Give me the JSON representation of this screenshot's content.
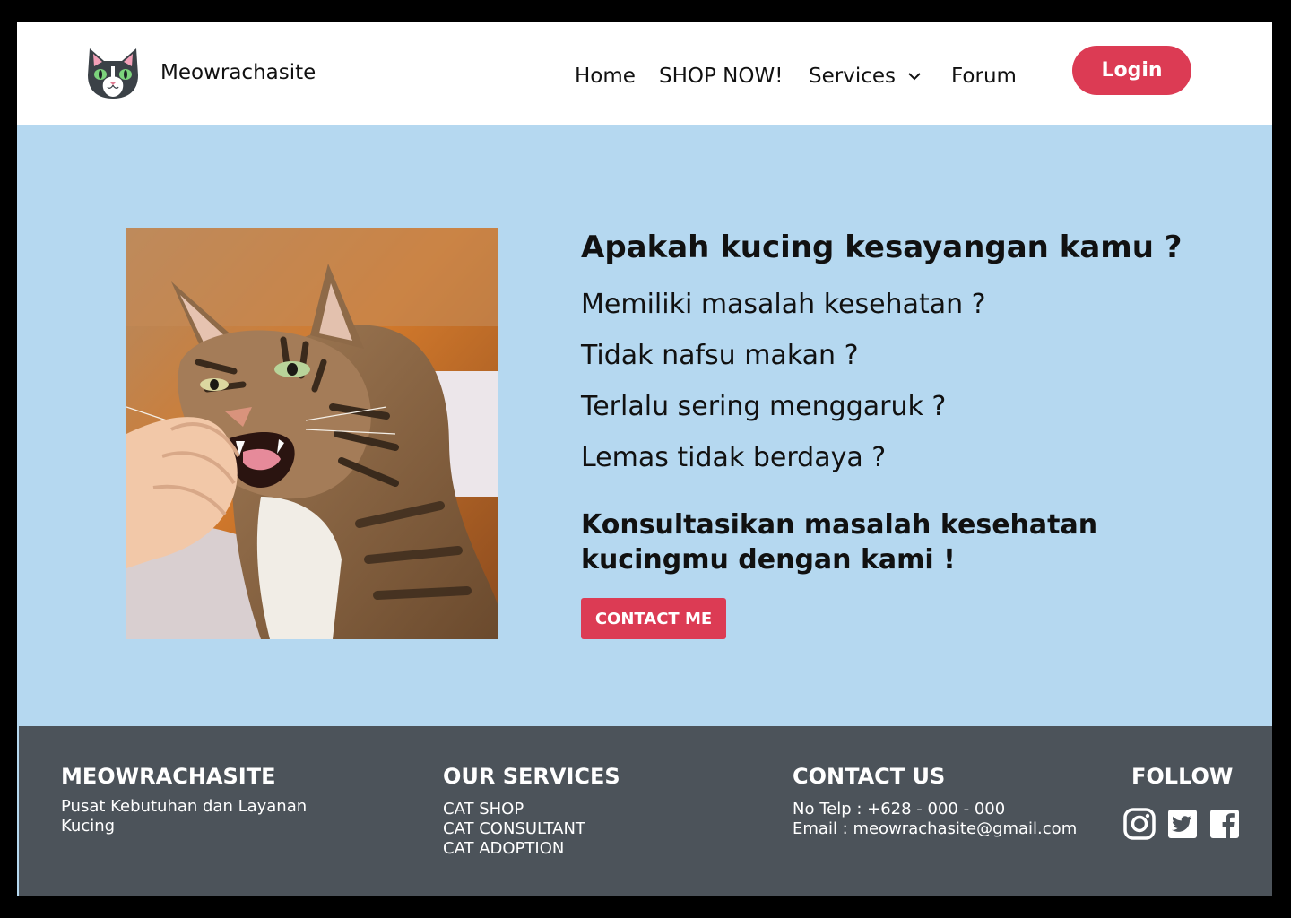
{
  "header": {
    "brand": "Meowrachasite",
    "nav": {
      "home": "Home",
      "shop": "SHOP NOW!",
      "services": "Services",
      "forum": "Forum"
    },
    "login_label": "Login"
  },
  "hero": {
    "title": "Apakah kucing kesayangan kamu ?",
    "questions": [
      "Memiliki masalah kesehatan ?",
      "Tidak nafsu makan ?",
      "Terlalu sering menggaruk ?",
      "Lemas tidak berdaya ?"
    ],
    "cta_title": "Konsultasikan masalah kesehatan kucingmu dengan kami !",
    "contact_label": "CONTACT ME"
  },
  "footer": {
    "brand": {
      "heading": "MEOWRACHASITE",
      "tagline": "Pusat Kebutuhan dan Layanan Kucing"
    },
    "services": {
      "heading": "OUR SERVICES",
      "items": [
        "CAT SHOP",
        "CAT CONSULTANT",
        "CAT ADOPTION"
      ]
    },
    "contact": {
      "heading": "CONTACT US",
      "phone": "No Telp : +628 - 000 - 000",
      "email": "Email : meowrachasite@gmail.com"
    },
    "follow": {
      "heading": "FOLLOW",
      "icons": [
        "instagram-icon",
        "twitter-icon",
        "facebook-icon"
      ]
    }
  },
  "colors": {
    "accent": "#dc3b54",
    "hero_bg": "#b5d8f0",
    "footer_bg": "#4c535a"
  }
}
